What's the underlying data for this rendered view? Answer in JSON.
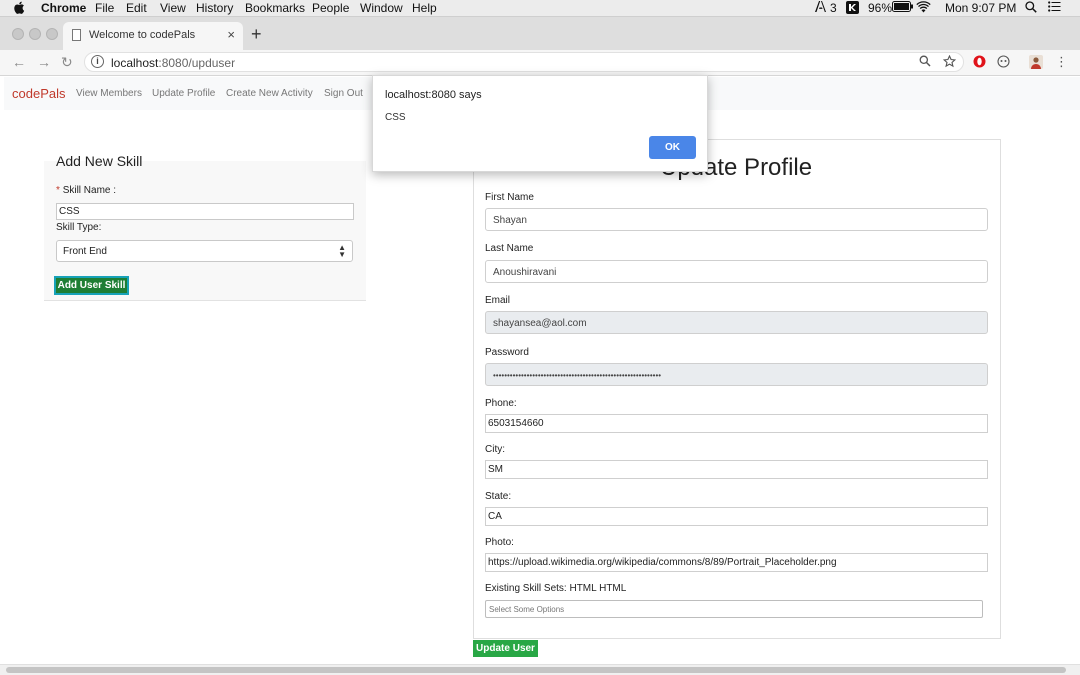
{
  "menubar": {
    "apple": "",
    "app": "Chrome",
    "items": [
      "File",
      "Edit",
      "View",
      "History",
      "Bookmarks",
      "People",
      "Window",
      "Help"
    ],
    "adobe_count": "3",
    "battery": "96%",
    "clock": "Mon 9:07 PM"
  },
  "browser": {
    "tab_title": "Welcome to codePals",
    "tab_close": "×",
    "new_tab": "+",
    "url_host": "localhost",
    "url_path": ":8080/upduser",
    "back": "←",
    "forward": "→",
    "reload": "↻",
    "menu": "⋮"
  },
  "nav": {
    "brand": "codePals",
    "links": [
      "View Members",
      "Update Profile",
      "Create New Activity",
      "Sign Out"
    ]
  },
  "skill_form": {
    "title": "Add New Skill",
    "required_mark": "*",
    "skill_name_label": "Skill Name :",
    "skill_name_value": "CSS",
    "skill_type_label": "Skill Type:",
    "skill_type_value": "Front End",
    "submit_label": "Add User Skill"
  },
  "profile_form": {
    "title": "Update Profile",
    "first_name_label": "First Name",
    "first_name_value": "Shayan",
    "last_name_label": "Last Name",
    "last_name_value": "Anoushiravani",
    "email_label": "Email",
    "email_value": "shayansea@aol.com",
    "password_label": "Password",
    "password_value": "••••••••••••••••••••••••••••••••••••••••••••••••••••••••••••",
    "phone_label": "Phone:",
    "phone_value": "6503154660",
    "city_label": "City:",
    "city_value": "SM",
    "state_label": "State:",
    "state_value": "CA",
    "photo_label": "Photo:",
    "photo_value": "https://upload.wikimedia.org/wikipedia/commons/8/89/Portrait_Placeholder.png",
    "skills_label": "Existing Skill Sets: HTML HTML",
    "skills_placeholder": "Select Some Options",
    "submit_label": "Update User"
  },
  "alert": {
    "title": "localhost:8080 says",
    "message": "CSS",
    "ok_label": "OK"
  },
  "colors": {
    "brand": "#c0392b",
    "primary_button": "#4a86e8",
    "success_button": "#28a745",
    "skill_button": "#1e7e34"
  }
}
